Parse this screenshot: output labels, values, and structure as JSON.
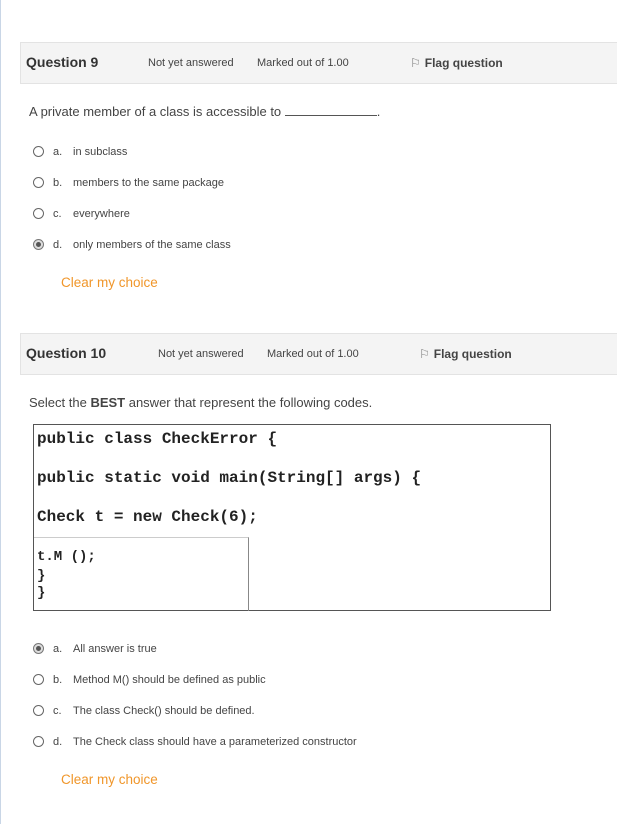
{
  "q9": {
    "number": "Question 9",
    "state": "Not yet answered",
    "grade": "Marked out of 1.00",
    "flag": "Flag question",
    "text": "A private member of a class is accessible to",
    "text_end": ".",
    "options": [
      {
        "letter": "a.",
        "text": "in subclass",
        "selected": false
      },
      {
        "letter": "b.",
        "text": "members to the same package",
        "selected": false
      },
      {
        "letter": "c.",
        "text": "everywhere",
        "selected": false
      },
      {
        "letter": "d.",
        "text": "only members of the same class",
        "selected": true
      }
    ],
    "clear": "Clear my choice"
  },
  "q10": {
    "number": "Question 10",
    "state": "Not yet answered",
    "grade": "Marked out of 1.00",
    "flag": "Flag question",
    "text_pre": "Select the ",
    "text_bold": "BEST",
    "text_post": " answer that represent the following codes.",
    "code": [
      "public class CheckError {",
      "public static void main(String[] args) {",
      "Check t = new Check(6);",
      "t.M ();",
      "}",
      "}"
    ],
    "options": [
      {
        "letter": "a.",
        "text": "All answer is true",
        "selected": true
      },
      {
        "letter": "b.",
        "text": "Method M() should be defined as public",
        "selected": false
      },
      {
        "letter": "c.",
        "text": "The class Check() should be defined.",
        "selected": false
      },
      {
        "letter": "d.",
        "text": "The Check class should have a parameterized constructor",
        "selected": false
      }
    ],
    "clear": "Clear my choice"
  },
  "icons": {
    "flag": "flag-icon",
    "radio": "radio-icon"
  }
}
